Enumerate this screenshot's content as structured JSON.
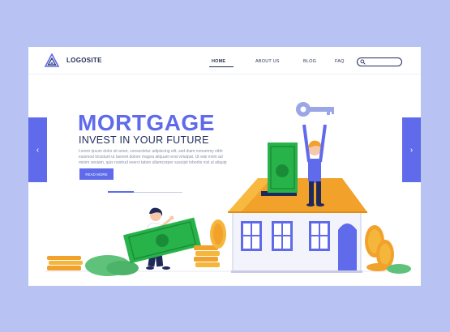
{
  "header": {
    "logo_text": "LOGOSITE",
    "nav": {
      "home": "HOME",
      "about": "ABOUT US",
      "blog": "BLOG",
      "faq": "FAQ"
    },
    "search": {
      "placeholder": ""
    }
  },
  "hero": {
    "title": "MORTGAGE",
    "subtitle": "INVEST IN YOUR FUTURE",
    "lorem": [
      "Lorem ipsum dolor sit amet, consectetur adipiscing elit, sed diam nonummy nibh",
      "euismod tincidunt ut laoreet dolore magna aliquam erat volutpat. Ut wisi enim ad",
      "minim veniam, quis nostrud exerci tation ullamcorper suscipit lobortis nisl ut aliquip"
    ],
    "button": "READ MORE"
  },
  "arrows": {
    "left": "‹",
    "right": "›"
  },
  "colors": {
    "background": "#b8c2f3",
    "accent": "#5f6bea",
    "dark": "#1f2a5a",
    "roof": "#f2a12a",
    "money": "#27b34a",
    "coins": "#f5a524"
  },
  "icons": [
    "logo-icon",
    "search-icon",
    "chevron-left-icon",
    "chevron-right-icon",
    "key-icon",
    "banknote-icon",
    "coin-stack-icon",
    "house-icon"
  ]
}
